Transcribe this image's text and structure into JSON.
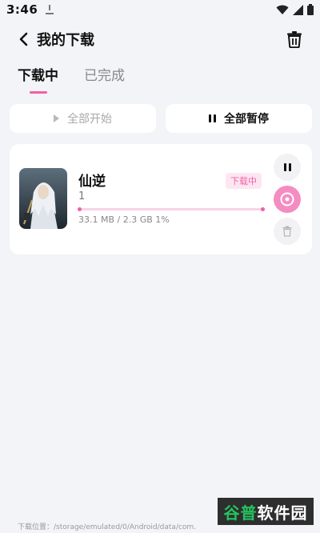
{
  "status": {
    "time": "3:46"
  },
  "header": {
    "title": "我的下载"
  },
  "tabs": [
    {
      "label": "下载中",
      "active": true
    },
    {
      "label": "已完成",
      "active": false
    }
  ],
  "actions": {
    "start_all": "全部开始",
    "pause_all": "全部暂停"
  },
  "download": {
    "name": "仙逆",
    "episode": "1",
    "status_badge": "下载中",
    "size_text": "33.1 MB / 2.3 GB  1%",
    "progress_percent": 1
  },
  "footer": {
    "path_label": "下载位置：/storage/emulated/0/Android/data/com."
  },
  "watermark": {
    "part1": "谷普",
    "part2": "软件园"
  },
  "colors": {
    "accent": "#f35fa8",
    "background": "#f3f4f8",
    "card": "#ffffff"
  }
}
